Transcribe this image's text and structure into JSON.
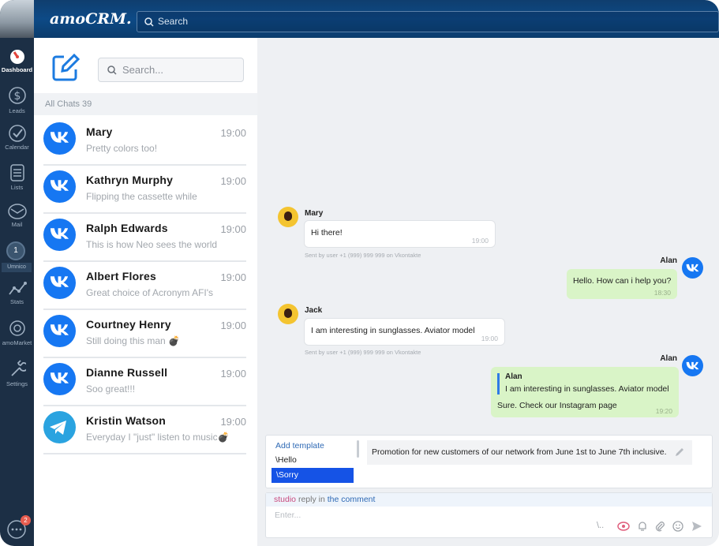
{
  "app": {
    "logo": "amoCRM.",
    "search_placeholder": "Search"
  },
  "rail": {
    "items": [
      {
        "label": "Dashboard",
        "icon": "dashboard-icon",
        "active": true
      },
      {
        "label": "Leads",
        "icon": "dollar-icon"
      },
      {
        "label": "Calendar",
        "icon": "check-circle-icon"
      },
      {
        "label": "Lists",
        "icon": "list-icon"
      },
      {
        "label": "Mail",
        "icon": "mail-icon"
      },
      {
        "label": "Stats",
        "icon": "stats-icon"
      },
      {
        "label": "amoMarket",
        "icon": "market-icon"
      },
      {
        "label": "Settings",
        "icon": "wrench-icon"
      }
    ],
    "badge_number": "1",
    "umnico_label": "Umnico",
    "chat_notification": "2"
  },
  "list": {
    "search_placeholder": "Search...",
    "all_chats_label": "All Chats",
    "all_chats_count": "39",
    "chats": [
      {
        "name": "Mary",
        "time": "19:00",
        "preview": "Pretty colors too!",
        "channel": "vk"
      },
      {
        "name": "Kathryn Murphy",
        "time": "19:00",
        "preview": "Flipping the cassette while",
        "channel": "vk"
      },
      {
        "name": "Ralph Edwards",
        "time": "19:00",
        "preview": "This is how Neo sees the world",
        "channel": "vk"
      },
      {
        "name": "Albert Flores",
        "time": "19:00",
        "preview": "Great choice of Acronym AFI's",
        "channel": "vk"
      },
      {
        "name": "Courtney Henry",
        "time": "19:00",
        "preview": "Still doing this man 💣",
        "channel": "vk"
      },
      {
        "name": "Dianne Russell",
        "time": "19:00",
        "preview": "Soo great!!!",
        "channel": "vk"
      },
      {
        "name": "Kristin Watson",
        "time": "19:00",
        "preview": "Everyday I \"just\" listen to music💣",
        "channel": "telegram"
      }
    ]
  },
  "conversation": {
    "messages": [
      {
        "sender": "Mary",
        "text": "Hi there!",
        "time": "19:00",
        "sent_by": "Sent by user +1 (999) 999 999 on Vkontakte"
      },
      {
        "sender": "Alan",
        "text": "Hello. How can i help you?",
        "time": "18:30"
      },
      {
        "sender": "Jack",
        "text": "I am interesting in sunglasses. Aviator model",
        "time": "19:00",
        "sent_by": "Sent by user +1 (999) 999 999 on Vkontakte"
      },
      {
        "sender": "Alan",
        "quote_author": "Alan",
        "quote_text": "I am interesting in sunglasses. Aviator model",
        "text": "Sure. Check our Instagram page",
        "time": "19:20"
      }
    ]
  },
  "templates": {
    "add_label": "Add template",
    "items": [
      "\\Hello",
      "\\Sorry"
    ],
    "preview": "Promotion for new customers of our network from June 1st to June 7th inclusive."
  },
  "composer": {
    "reply_user": "studio",
    "reply_middle": " reply in ",
    "reply_target": "the comment",
    "placeholder": "Enter...",
    "template_shortcut": "\\.."
  },
  "colors": {
    "vk": "#1677f2",
    "telegram": "#2aa3e0",
    "outgoing": "#d9f4c7",
    "selected_template": "#1553e6"
  }
}
